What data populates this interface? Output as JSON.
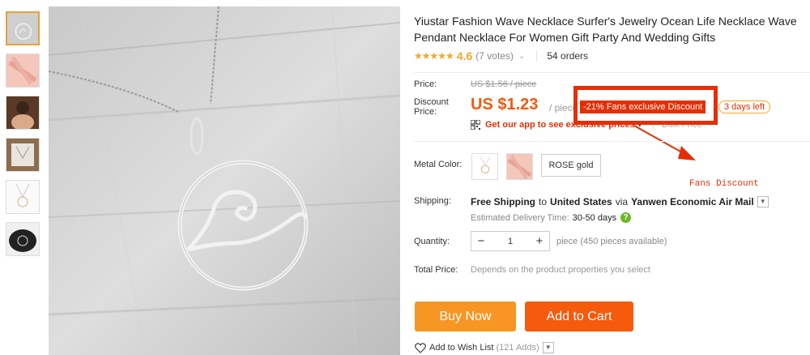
{
  "product": {
    "title": "Yiustar Fashion Wave Necklace Surfer's Jewelry Ocean Life Necklace Wave Pendant Necklace For Women Gift Party And Wedding Gifts",
    "stars": "★★★★★",
    "rating": "4.6",
    "votes": "(7 votes)",
    "orders": "54 orders"
  },
  "price": {
    "price_label": "Price:",
    "old_price": "US $1.56 / piece",
    "discount_label": "Discount Price:",
    "current_price": "US $1.23",
    "per_piece": "/ piece",
    "fans_badge": "-21% Fans exclusive Discount",
    "days_left": "3 days left",
    "app_link": "Get our app to see exclusive prices",
    "bulk_price": "Bulk Price",
    "annotation": "Fans Discount"
  },
  "options": {
    "metal_color_label": "Metal Color:",
    "rose_gold": "ROSE gold"
  },
  "shipping": {
    "label": "Shipping:",
    "free_shipping": "Free Shipping",
    "to_text": "to",
    "destination": "United States",
    "via_text": "via",
    "method": "Yanwen Economic Air Mail",
    "eta_label": "Estimated Delivery Time:",
    "eta_value": "30-50 days"
  },
  "quantity": {
    "label": "Quantity:",
    "minus": "−",
    "value": "1",
    "plus": "+",
    "available": "piece (450 pieces available)"
  },
  "total": {
    "label": "Total Price:",
    "description": "Depends on the product properties you select"
  },
  "actions": {
    "buy_now": "Buy Now",
    "add_to_cart": "Add to Cart",
    "wish_list": "Add to Wish List",
    "wish_count": "(121 Adds)"
  },
  "colors": {
    "accent_orange": "#f45a0b",
    "buy_now": "#f89623",
    "add_to_cart": "#f55a0d",
    "badge_red": "#e62e04",
    "star": "#f5a623"
  }
}
